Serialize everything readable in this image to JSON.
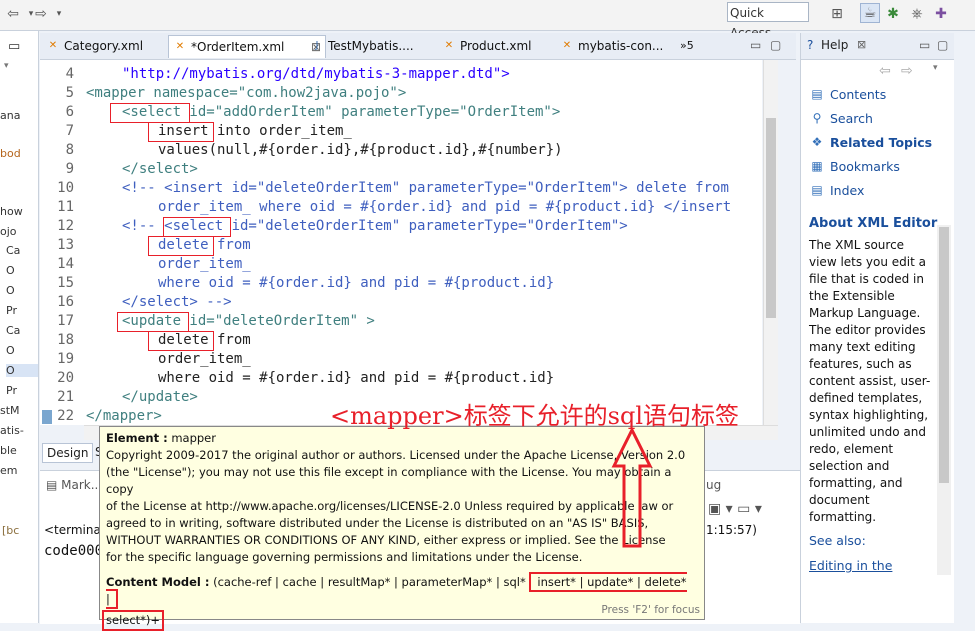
{
  "toolbar": {
    "quick_access_placeholder": "Quick Access"
  },
  "left_strip": {
    "items": [
      "ana",
      "bod",
      "how",
      "ojo",
      "Ca",
      "O",
      "O",
      "Pr",
      "Ca",
      "O",
      "O",
      "Pr",
      "stM",
      "atis-",
      "ble",
      "em",
      "[bc",
      "code000"
    ]
  },
  "editor": {
    "tabs": [
      {
        "label": "Category.xml",
        "icon": "xml-file-icon"
      },
      {
        "label": "*OrderItem.xml",
        "icon": "xml-file-icon",
        "active": true
      },
      {
        "label": "TestMybatis....",
        "icon": "java-file-icon"
      },
      {
        "label": "Product.xml",
        "icon": "xml-file-icon"
      },
      {
        "label": "mybatis-con...",
        "icon": "xml-file-icon"
      },
      {
        "label": "»5",
        "icon": ""
      }
    ],
    "line_numbers": [
      "4",
      "5",
      "6",
      "7",
      "8",
      "9",
      "10",
      "11",
      "12",
      "13",
      "14",
      "15",
      "16",
      "17",
      "18",
      "19",
      "20",
      "21",
      "22"
    ],
    "code_lines": [
      "\"http://mybatis.org/dtd/mybatis-3-mapper.dtd\">",
      "<mapper namespace=\"com.how2java.pojo\">",
      "<select id=\"addOrderItem\" parameterType=\"OrderItem\">",
      "insert into order_item_",
      "values(null,#{order.id},#{product.id},#{number})",
      "</select>",
      "<!-- <insert id=\"deleteOrderItem\" parameterType=\"OrderItem\"> delete from",
      "order_item_ where oid = #{order.id} and pid = #{product.id} </insert",
      "<!-- <select id=\"deleteOrderItem\" parameterType=\"OrderItem\">",
      "delete from",
      "order_item_",
      "where oid = #{order.id} and pid = #{product.id}",
      "</select> -->",
      "<update id=\"deleteOrderItem\" >",
      "delete from",
      "order_item_",
      "where oid = #{order.id} and pid = #{product.id}",
      "</update>",
      "</mapper>"
    ],
    "design_tab": "Design",
    "source_tab_initial": "S"
  },
  "bottom": {
    "markers_tab": "Mark...",
    "debug_tab": "ug",
    "terminated": "<terminate",
    "time": "1:15:57)",
    "console_line": "code000"
  },
  "popup": {
    "element_label": "Element :",
    "element_value": "mapper",
    "license_lines": [
      "Copyright 2009-2017 the original author or authors. Licensed under the Apache License, Version 2.0",
      "(the \"License\"); you may not use this file except in compliance with the License. You may obtain a copy",
      "of the License at http://www.apache.org/licenses/LICENSE-2.0 Unless required by applicable law or",
      "agreed to in writing, software distributed under the License is distributed on an \"AS IS\" BASIS,",
      "WITHOUT WARRANTIES OR CONDITIONS OF ANY KIND, either express or implied. See the License",
      "for the specific language governing permissions and limitations under the License."
    ],
    "content_model_label": "Content Model :",
    "content_model_prefix": "(cache-ref | cache | resultMap* | parameterMap* | sql*",
    "content_model_highlight": "insert* | update* | delete* |",
    "content_model_end": "select*)+",
    "focus_hint": "Press 'F2' for focus"
  },
  "help": {
    "tab_label": "Help",
    "links": [
      {
        "label": "Contents",
        "icon": "book-icon"
      },
      {
        "label": "Search",
        "icon": "search-icon"
      },
      {
        "label": "Related Topics",
        "icon": "related-topics-icon",
        "bold": true
      },
      {
        "label": "Bookmarks",
        "icon": "bookmark-icon"
      },
      {
        "label": "Index",
        "icon": "index-icon"
      }
    ],
    "about_title": "About XML Editor",
    "about_text": "The XML source view lets you edit a file that is coded in the Extensible Markup Language. The editor provides many text editing features, such as content assist, user-defined templates, syntax highlighting, unlimited undo and redo, element selection and formatting, and document formatting.",
    "see_also": "See also:",
    "see_also_link": "Editing in the"
  },
  "annotation": {
    "text": "<mapper>标签下允许的sql语句标签",
    "color": "#e8202a"
  }
}
